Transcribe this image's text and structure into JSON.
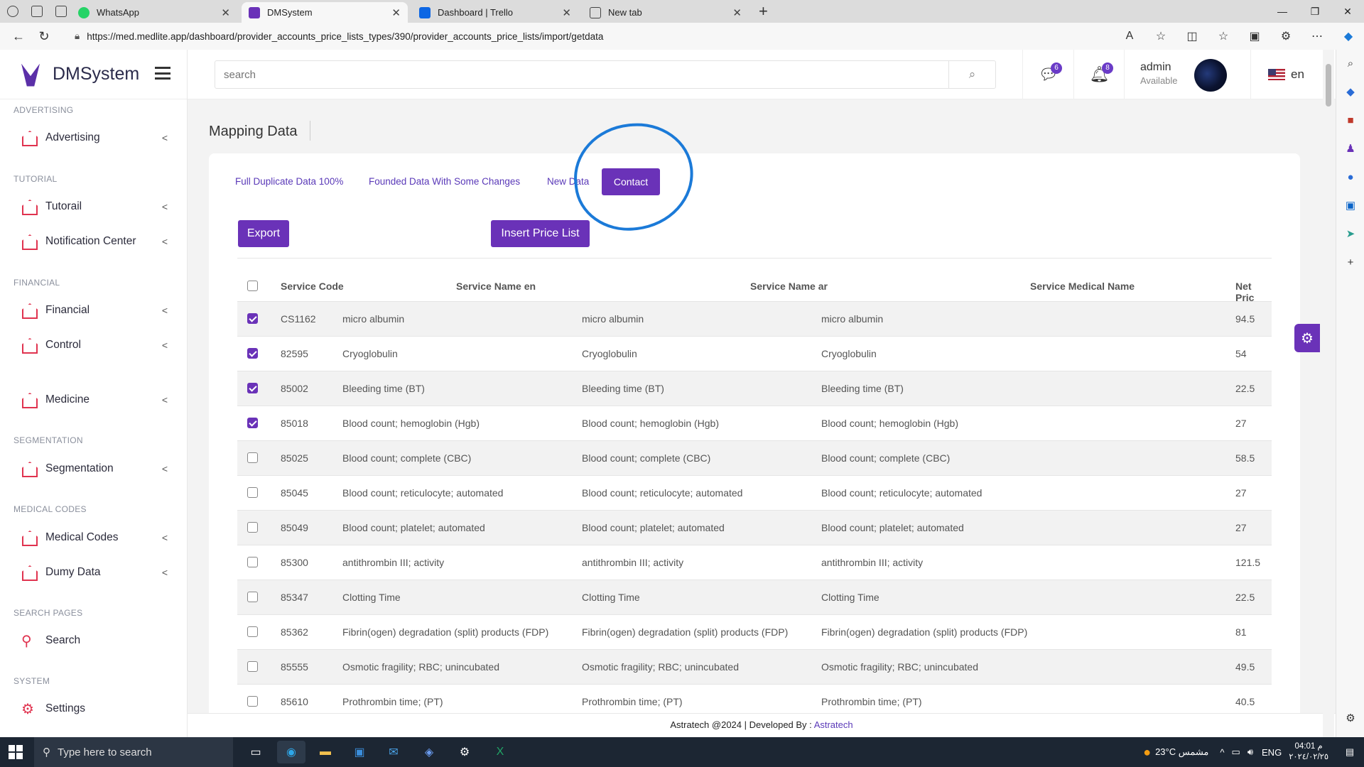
{
  "browser": {
    "tabs": [
      {
        "title": "WhatsApp",
        "color": "#25d366"
      },
      {
        "title": "DMSystem",
        "color": "#6a32b8"
      },
      {
        "title": "Dashboard | Trello",
        "color": "#0c66e4"
      },
      {
        "title": "New tab",
        "color": "#444444"
      }
    ],
    "url": "https://med.medlite.app/dashboard/provider_accounts_price_lists_types/390/provider_accounts_price_lists/import/getdata"
  },
  "brand": {
    "name": "DMSystem"
  },
  "sidebar": {
    "sections": [
      {
        "label": "ADVERTISING"
      },
      {
        "label": "TUTORIAL"
      },
      {
        "label": "FINANCIAL"
      },
      {
        "label": "SEGMENTATION"
      },
      {
        "label": "MEDICAL CODES"
      },
      {
        "label": "SEARCH PAGES"
      },
      {
        "label": "SYSTEM"
      }
    ],
    "items": [
      {
        "label": "Advertising"
      },
      {
        "label": "Tutorail"
      },
      {
        "label": "Notification Center"
      },
      {
        "label": "Financial"
      },
      {
        "label": "Control"
      },
      {
        "label": "Medicine"
      },
      {
        "label": "Segmentation"
      },
      {
        "label": "Medical Codes"
      },
      {
        "label": "Dumy Data"
      },
      {
        "label": "Search"
      },
      {
        "label": "Settings"
      }
    ]
  },
  "topbar": {
    "search_placeholder": "search",
    "messages_count": "6",
    "notifications_count": "8",
    "user_name": "admin",
    "user_status": "Available",
    "language": "en"
  },
  "page": {
    "title": "Mapping Data",
    "filter_tabs": [
      "Full Duplicate Data 100%",
      "Founded Data With Some Changes",
      "New Data",
      "Contact"
    ],
    "export_label": "Export",
    "insert_label": "Insert Price List"
  },
  "table": {
    "headers": [
      "Service Code",
      "Service Name en",
      "Service Name ar",
      "Service Medical Name",
      "Net Pric"
    ],
    "rows": [
      {
        "checked": true,
        "code": "CS1162",
        "name_en": "micro albumin",
        "name_ar": "micro albumin",
        "medical": "micro albumin",
        "price": "94.5"
      },
      {
        "checked": true,
        "code": "82595",
        "name_en": "Cryoglobulin",
        "name_ar": "Cryoglobulin",
        "medical": "Cryoglobulin",
        "price": "54"
      },
      {
        "checked": true,
        "code": "85002",
        "name_en": "Bleeding time (BT)",
        "name_ar": "Bleeding time (BT)",
        "medical": "Bleeding time (BT)",
        "price": "22.5"
      },
      {
        "checked": true,
        "code": "85018",
        "name_en": "Blood count; hemoglobin (Hgb)",
        "name_ar": "Blood count; hemoglobin (Hgb)",
        "medical": "Blood count; hemoglobin (Hgb)",
        "price": "27"
      },
      {
        "checked": false,
        "code": "85025",
        "name_en": "Blood count; complete (CBC)",
        "name_ar": "Blood count; complete (CBC)",
        "medical": "Blood count; complete (CBC)",
        "price": "58.5"
      },
      {
        "checked": false,
        "code": "85045",
        "name_en": "Blood count; reticulocyte; automated",
        "name_ar": "Blood count; reticulocyte; automated",
        "medical": "Blood count; reticulocyte; automated",
        "price": "27"
      },
      {
        "checked": false,
        "code": "85049",
        "name_en": "Blood count; platelet; automated",
        "name_ar": "Blood count; platelet; automated",
        "medical": "Blood count; platelet; automated",
        "price": "27"
      },
      {
        "checked": false,
        "code": "85300",
        "name_en": "antithrombin III; activity",
        "name_ar": "antithrombin III; activity",
        "medical": "antithrombin III; activity",
        "price": "121.5"
      },
      {
        "checked": false,
        "code": "85347",
        "name_en": "Clotting Time",
        "name_ar": "Clotting Time",
        "medical": "Clotting Time",
        "price": "22.5"
      },
      {
        "checked": false,
        "code": "85362",
        "name_en": "Fibrin(ogen) degradation (split) products (FDP)",
        "name_ar": "Fibrin(ogen) degradation (split) products (FDP)",
        "medical": "Fibrin(ogen) degradation (split) products (FDP)",
        "price": "81"
      },
      {
        "checked": false,
        "code": "85555",
        "name_en": "Osmotic fragility; RBC; unincubated",
        "name_ar": "Osmotic fragility; RBC; unincubated",
        "medical": "Osmotic fragility; RBC; unincubated",
        "price": "49.5"
      },
      {
        "checked": false,
        "code": "85610",
        "name_en": "Prothrombin time; (PT)",
        "name_ar": "Prothrombin time; (PT)",
        "medical": "Prothrombin time; (PT)",
        "price": "40.5"
      }
    ]
  },
  "footer": {
    "text": "Astratech @2024 | Developed By : ",
    "link": "Astratech"
  },
  "taskbar": {
    "search_placeholder": "Type here to search",
    "weather": "23°C  مشمس",
    "lang": "ENG",
    "time": "04:01 م",
    "date": "٢٠٢٤/٠٢/٢٥"
  },
  "colors": {
    "accent": "#6a32b8",
    "annotation_circle": "#1b7ad8"
  }
}
